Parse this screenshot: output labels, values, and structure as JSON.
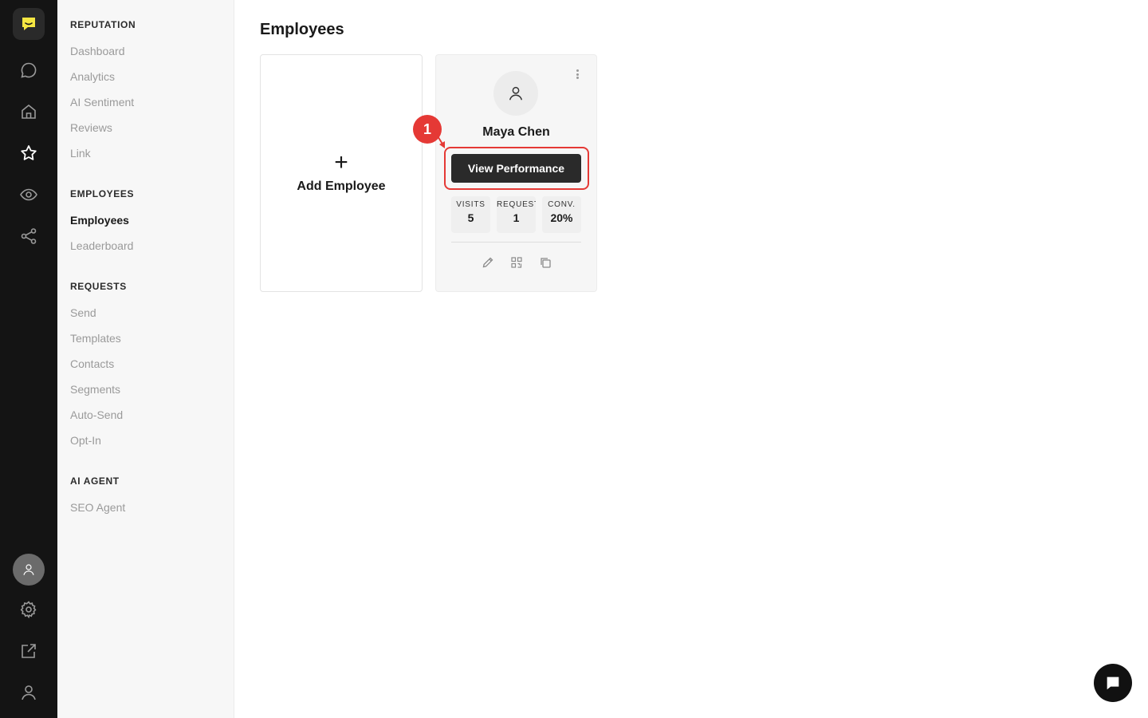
{
  "rail": {
    "items": [
      {
        "icon": "chat-bubble-icon"
      },
      {
        "icon": "home-icon"
      },
      {
        "icon": "star-icon"
      },
      {
        "icon": "eye-icon"
      },
      {
        "icon": "share-icon"
      }
    ],
    "bottom": [
      {
        "icon": "avatar-icon"
      },
      {
        "icon": "gear-icon"
      },
      {
        "icon": "external-link-icon"
      },
      {
        "icon": "user-icon"
      }
    ],
    "accent": "#f5e642"
  },
  "nav": {
    "groups": [
      {
        "title": "REPUTATION",
        "items": [
          "Dashboard",
          "Analytics",
          "AI Sentiment",
          "Reviews",
          "Link"
        ]
      },
      {
        "title": "EMPLOYEES",
        "items": [
          "Employees",
          "Leaderboard"
        ]
      },
      {
        "title": "REQUESTS",
        "items": [
          "Send",
          "Templates",
          "Contacts",
          "Segments",
          "Auto-Send",
          "Opt-In"
        ]
      },
      {
        "title": "AI AGENT",
        "items": [
          "SEO Agent"
        ]
      }
    ],
    "active": "Employees"
  },
  "main": {
    "title": "Employees",
    "add_card": {
      "plus": "+",
      "label": "Add Employee"
    },
    "employee": {
      "name": "Maya Chen",
      "button": "View Performance",
      "stats": [
        {
          "label": "VISITS",
          "value": "5"
        },
        {
          "label": "REQUESTS",
          "value": "1"
        },
        {
          "label": "CONV.",
          "value": "20%"
        }
      ]
    }
  },
  "annotation": {
    "step": "1",
    "color": "#e53935"
  }
}
